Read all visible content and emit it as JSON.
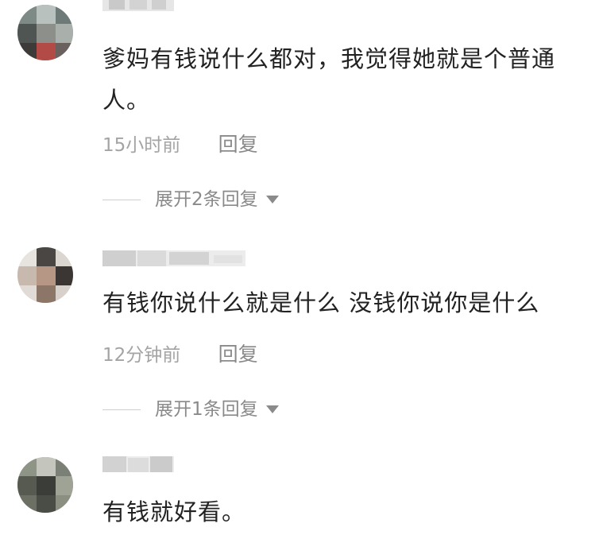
{
  "comments": [
    {
      "text": "爹妈有钱说什么都对，我觉得她就是个普通人。",
      "time": "15小时前",
      "reply_label": "回复",
      "expand_label": "展开2条回复"
    },
    {
      "text": "有钱你说什么就是什么 没钱你说你是什么",
      "time": "12分钟前",
      "reply_label": "回复",
      "expand_label": "展开1条回复"
    },
    {
      "text": "有钱就好看。"
    }
  ],
  "colors": {
    "text": "#222222",
    "meta": "#a4a4a4",
    "action": "#8a8a8a"
  },
  "icons": [
    "caret-down-icon"
  ]
}
